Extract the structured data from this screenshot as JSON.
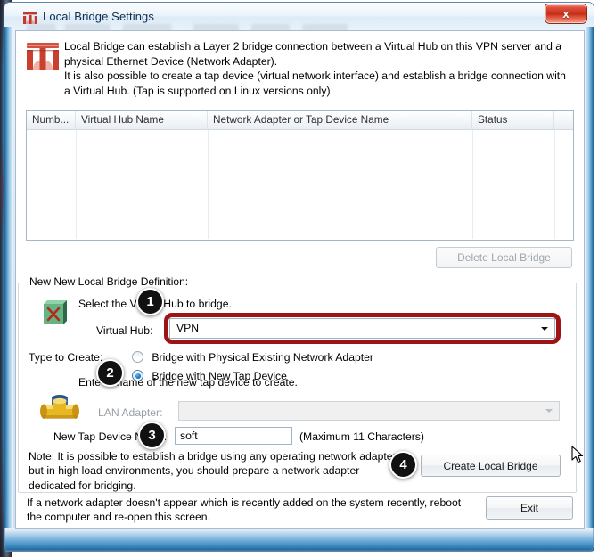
{
  "window": {
    "title": "Local Bridge Settings",
    "title_icon": "bridge-icon",
    "close_label": "x"
  },
  "description": {
    "icon": "bridge-icon",
    "text": "Local Bridge can establish a Layer 2 bridge connection between a Virtual Hub on this VPN server and a physical Ethernet Device (Network Adapter).\nIt is also possible to create a tap device (virtual network interface) and establish a bridge connection with a Virtual Hub. (Tap is supported on Linux versions only)"
  },
  "list": {
    "columns": [
      "Numb...",
      "Virtual Hub Name",
      "Network Adapter or Tap Device Name",
      "Status",
      ""
    ],
    "rows": []
  },
  "buttons": {
    "delete_local_bridge": "Delete Local Bridge",
    "create_local_bridge": "Create Local Bridge",
    "exit": "Exit"
  },
  "group": {
    "title": "New New Local Bridge Definition:",
    "select_hub_label": "Select the Virtual Hub to bridge.",
    "virtual_hub_label": "Virtual Hub:",
    "virtual_hub_value": "VPN",
    "type_label": "Type to Create:",
    "radio_physical": "Bridge with Physical Existing Network Adapter",
    "radio_tap": "Bridge with New Tap Device",
    "radio_selected": "tap",
    "enter_name_label": "Enter a name of the new tap device to create.",
    "lan_adapter_label": "LAN Adapter:",
    "lan_adapter_value": "",
    "tap_name_label": "New Tap Device Name:",
    "tap_name_value": "soft",
    "max_chars_label": "(Maximum 11 Characters)",
    "note": "Note: It is possible to establish a bridge using any operating network adapter, but in high load environments, you should prepare a network adapter dedicated for bridging."
  },
  "footer": {
    "note": "If a network adapter doesn't appear which is recently added on the system recently, reboot the computer and re-open this screen."
  },
  "badges": {
    "one": "1",
    "two": "2",
    "three": "3",
    "four": "4"
  },
  "colors": {
    "highlight": "#9e1414",
    "badge_bg": "#111111",
    "close_red": "#c32f18"
  }
}
